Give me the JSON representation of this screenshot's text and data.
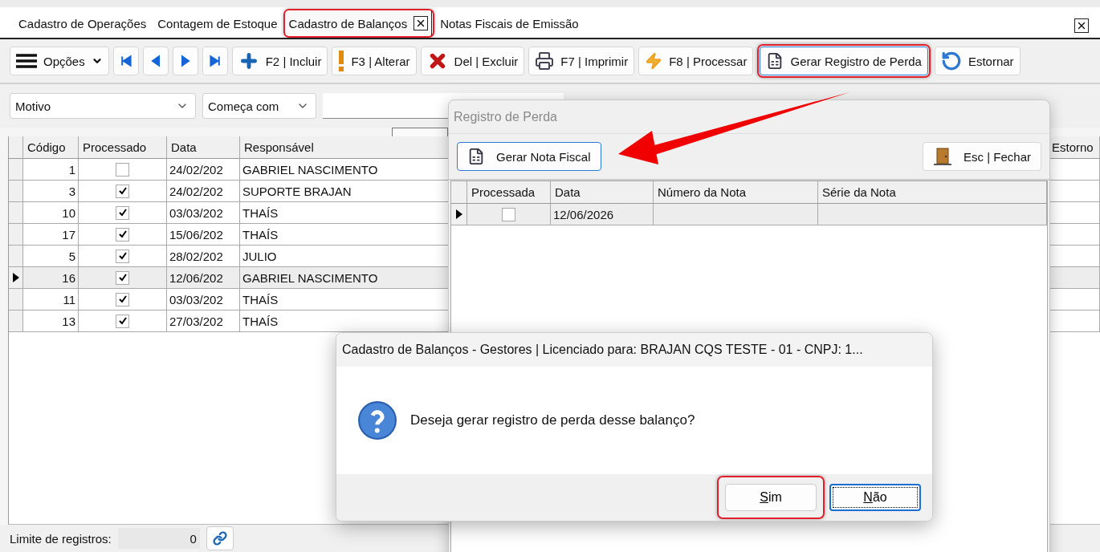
{
  "tabs": [
    {
      "label": "Cadastro de Operações",
      "selected": false,
      "highlighted": false
    },
    {
      "label": "Contagem de Estoque",
      "selected": false,
      "highlighted": false
    },
    {
      "label": "Cadastro de Balanços",
      "selected": true,
      "highlighted": true
    },
    {
      "label": "Notas Fiscais de Emissão",
      "selected": false,
      "highlighted": false
    }
  ],
  "toolbar": [
    {
      "kind": "menu",
      "label": "Opções",
      "highlighted": false,
      "focused": false
    },
    {
      "kind": "first",
      "highlighted": false,
      "focused": false
    },
    {
      "kind": "prev",
      "highlighted": false,
      "focused": false
    },
    {
      "kind": "next",
      "highlighted": false,
      "focused": false
    },
    {
      "kind": "last",
      "highlighted": false,
      "focused": false
    },
    {
      "kind": "plus",
      "label": "F2 | Incluir",
      "highlighted": false,
      "focused": false
    },
    {
      "kind": "exclamation",
      "label": "F3 | Alterar",
      "highlighted": false,
      "focused": false
    },
    {
      "kind": "cross",
      "label": "Del | Excluir",
      "highlighted": false,
      "focused": false
    },
    {
      "kind": "printer",
      "label": "F7 | Imprimir",
      "highlighted": false,
      "focused": false
    },
    {
      "kind": "bolt",
      "label": "F8 | Processar",
      "highlighted": false,
      "focused": false
    },
    {
      "kind": "document",
      "label": "Gerar Registro de Perda",
      "highlighted": true,
      "focused": true
    },
    {
      "kind": "undo",
      "label": "Estornar",
      "highlighted": false,
      "focused": false
    }
  ],
  "filter": {
    "field": "Motivo",
    "operator": "Começa com"
  },
  "grid": {
    "columns": [
      "Código",
      "Processado",
      "Data",
      "Responsável",
      "Estorno"
    ],
    "rows": [
      {
        "code": "1",
        "processed": false,
        "date": "24/02/202",
        "responsible": "GABRIEL NASCIMENTO",
        "selected": false
      },
      {
        "code": "3",
        "processed": true,
        "date": "24/02/202",
        "responsible": "SUPORTE BRAJAN",
        "selected": false
      },
      {
        "code": "10",
        "processed": true,
        "date": "03/03/202",
        "responsible": "THAÍS",
        "selected": false
      },
      {
        "code": "17",
        "processed": true,
        "date": "15/06/202",
        "responsible": "THAÍS",
        "selected": false
      },
      {
        "code": "5",
        "processed": true,
        "date": "28/02/202",
        "responsible": "JULIO",
        "selected": false
      },
      {
        "code": "16",
        "processed": true,
        "date": "12/06/202",
        "responsible": "GABRIEL NASCIMENTO",
        "selected": true
      },
      {
        "code": "11",
        "processed": true,
        "date": "03/03/202",
        "responsible": "THAÍS",
        "selected": false
      },
      {
        "code": "13",
        "processed": true,
        "date": "27/03/202",
        "responsible": "THAÍS",
        "selected": false
      }
    ]
  },
  "footer": {
    "label": "Limite de registros:",
    "value": "0"
  },
  "registro_dialog": {
    "title": "Registro de Perda",
    "buttons": [
      {
        "kind": "document",
        "label": "Gerar Nota Fiscal",
        "focused": true
      },
      {
        "kind": "door",
        "label": "Esc | Fechar",
        "focused": false
      }
    ],
    "columns": [
      "Processada",
      "Data",
      "Número da Nota",
      "Série da Nota"
    ],
    "rows": [
      {
        "processed": false,
        "date": "12/06/2026",
        "selected": true
      }
    ]
  },
  "message_box": {
    "title": "Cadastro de Balanços - Gestores | Licenciado para: BRAJAN CQS TESTE - 01 - CNPJ: 1...",
    "message": "Deseja gerar registro de perda desse balanço?",
    "buttons": [
      {
        "label": "Sim",
        "focused": false,
        "highlighted": true
      },
      {
        "label": "Não",
        "focused": true,
        "highlighted": false
      }
    ]
  }
}
